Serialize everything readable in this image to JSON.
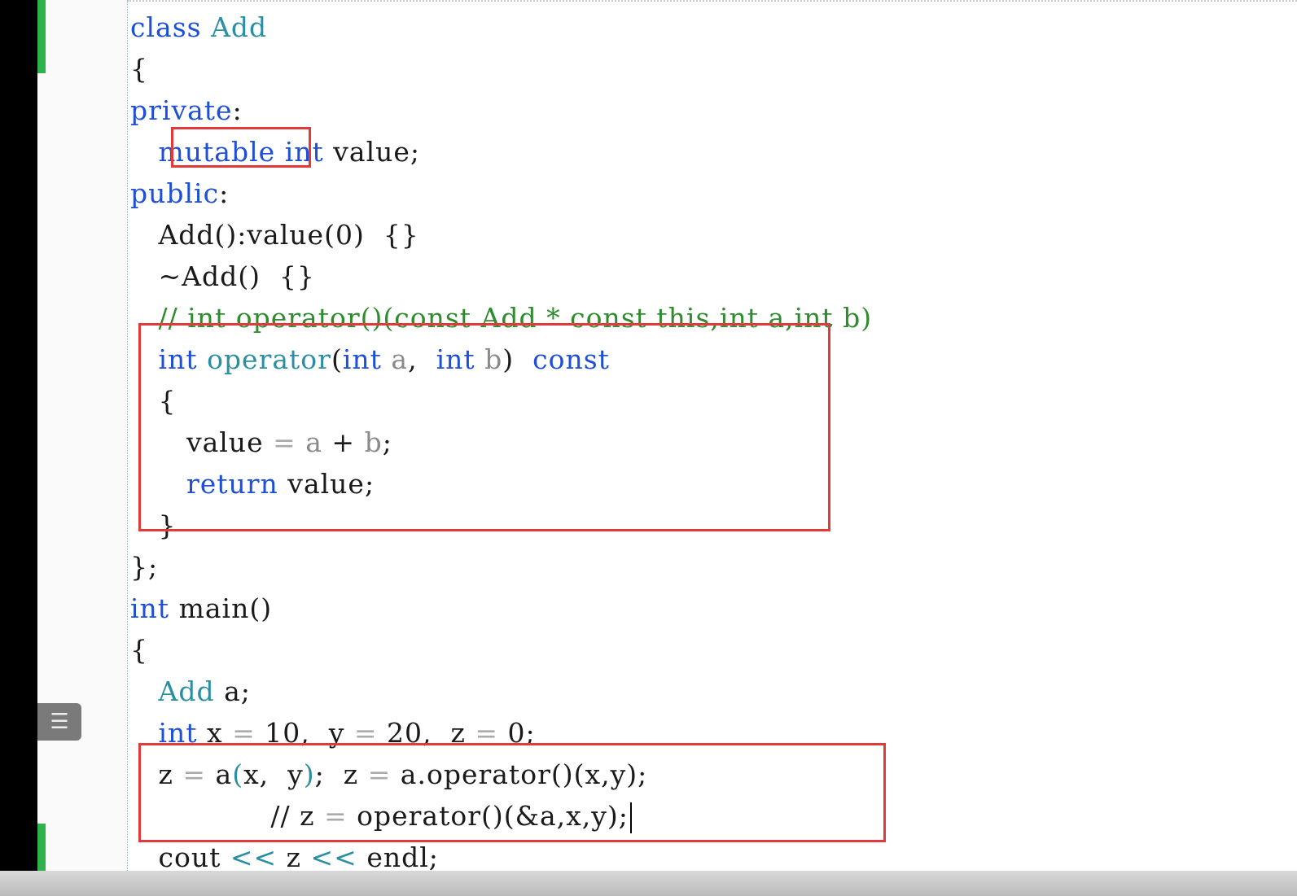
{
  "editor": {
    "menu_icon": "list-icon",
    "lines": [
      [
        "class ",
        "Add"
      ],
      [
        "{"
      ],
      [
        "private",
        ":"
      ],
      [
        "   ",
        "mutable",
        " ",
        "int",
        " value;"
      ],
      [
        "public",
        ":"
      ],
      [
        "   Add():value(0)  {}"
      ],
      [
        "   ~Add()  {}"
      ],
      [
        "   // int operator()(const Add * const this,int a,int b)"
      ],
      [
        "   ",
        "int",
        " ",
        "operator",
        "(",
        "int",
        " ",
        "a",
        ",  ",
        "int",
        " ",
        "b",
        ")  ",
        "const"
      ],
      [
        "   {"
      ],
      [
        "      value ",
        "=",
        " ",
        "a",
        " + ",
        "b",
        ";"
      ],
      [
        "      ",
        "return",
        " value;"
      ],
      [
        "   }"
      ],
      [
        "};"
      ],
      [
        "int",
        " main()"
      ],
      [
        "{"
      ],
      [
        "   ",
        "Add",
        " a;"
      ],
      [
        "   ",
        "int",
        " x ",
        "=",
        " 10,  y ",
        "=",
        " 20,  z ",
        "=",
        " 0;"
      ],
      [
        "   z ",
        "=",
        " a",
        "(",
        "x,  y",
        ")",
        ";  z ",
        "=",
        " a.operator()(x,y);"
      ],
      [
        "               // z ",
        "=",
        " operator()(&a,x,y);"
      ],
      [
        "   cout ",
        "<<",
        " z ",
        "<<",
        " endl;"
      ]
    ]
  },
  "colors": {
    "keyword": "#1f4fd6",
    "type": "#2b8fa3",
    "comment": "#2e8b2e",
    "highlight_box": "#e03a3a",
    "change_bar": "#2db34a"
  }
}
